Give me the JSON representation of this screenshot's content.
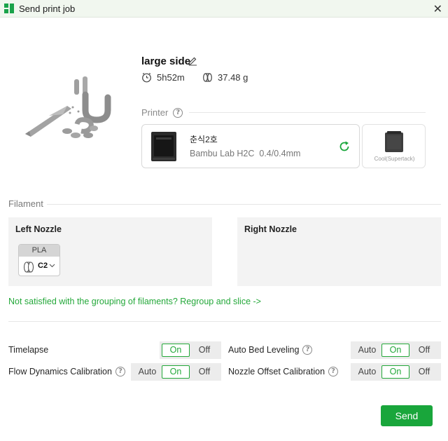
{
  "window": {
    "title": "Send print job",
    "close_glyph": "✕"
  },
  "job": {
    "name": "large side",
    "time": "5h52m",
    "weight": "37.48 g"
  },
  "printer_section": {
    "title": "Printer",
    "help": "?"
  },
  "printer": {
    "name": "춘식2호",
    "model": "Bambu Lab H2C",
    "nozzle": "0.4/0.4mm"
  },
  "tool": {
    "label": "Cool(Supertack)"
  },
  "filament_section": {
    "title": "Filament"
  },
  "left_nozzle": {
    "title": "Left Nozzle",
    "filament_type": "PLA",
    "slot": "C2"
  },
  "right_nozzle": {
    "title": "Right Nozzle"
  },
  "regroup_link": "Not satisfied with the grouping of filaments? Regroup and slice ->",
  "options": {
    "timelapse": {
      "label": "Timelapse",
      "on": "On",
      "off": "Off",
      "selected": "On"
    },
    "auto_bed_leveling": {
      "label": "Auto Bed Leveling",
      "help": "?",
      "auto": "Auto",
      "on": "On",
      "off": "Off",
      "selected": "On"
    },
    "flow_dynamics": {
      "label": "Flow Dynamics Calibration",
      "help": "?",
      "auto": "Auto",
      "on": "On",
      "off": "Off",
      "selected": "On"
    },
    "nozzle_offset": {
      "label": "Nozzle Offset Calibration",
      "help": "?",
      "auto": "Auto",
      "on": "On",
      "off": "Off",
      "selected": "On"
    }
  },
  "send_button": "Send",
  "colors": {
    "accent": "#19a63b",
    "link": "#24a83a",
    "titlebar": "#f1f7ef",
    "panel": "#f3f3f3"
  },
  "icons": {
    "app": "bambu-studio-logo-icon",
    "close": "close-icon",
    "edit": "pencil-icon",
    "clock": "clock-icon",
    "weight": "filament-spool-icon",
    "help": "question-circle-icon",
    "refresh": "refresh-icon",
    "spool": "spool-icon",
    "chevron": "chevron-down-icon"
  }
}
